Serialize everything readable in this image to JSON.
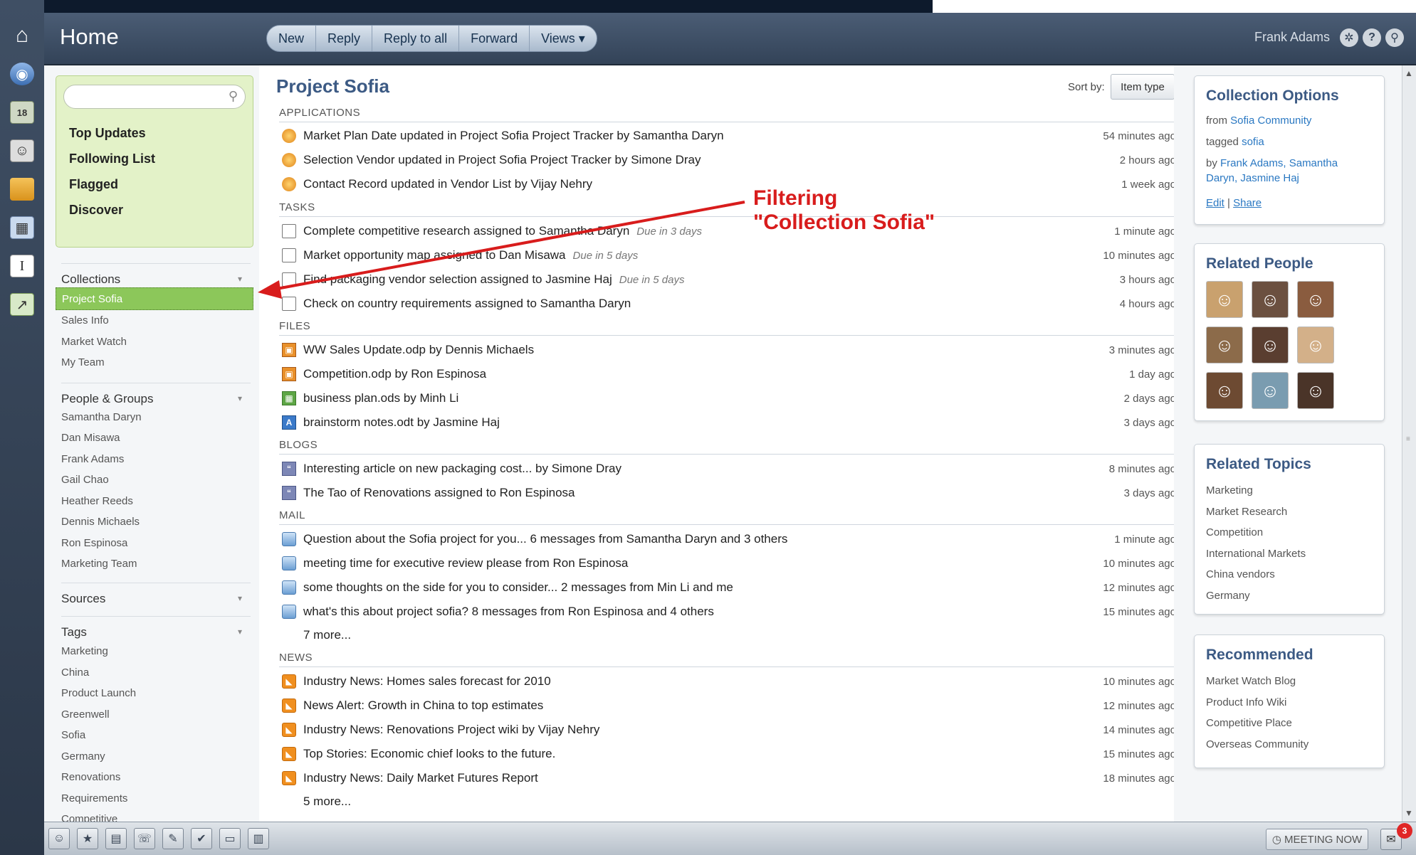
{
  "header": {
    "title": "Home",
    "toolbar": [
      "New",
      "Reply",
      "Reply to all",
      "Forward",
      "Views ▾"
    ],
    "user": "Frank Adams"
  },
  "left": {
    "search_placeholder": "",
    "nav": [
      "Top Updates",
      "Following List",
      "Flagged",
      "Discover"
    ],
    "collections": {
      "title": "Collections",
      "selected": "Project Sofia",
      "items": [
        "Sales Info",
        "Market Watch",
        "My Team"
      ]
    },
    "people": {
      "title": "People & Groups",
      "items": [
        "Samantha Daryn",
        "Dan Misawa",
        "Frank Adams",
        "Gail Chao",
        "Heather Reeds",
        "Dennis Michaels",
        "Ron Espinosa",
        "Marketing Team"
      ]
    },
    "sources": {
      "title": "Sources"
    },
    "tags": {
      "title": "Tags",
      "items": [
        "Marketing",
        "China",
        "Product Launch",
        "Greenwell",
        "Sofia",
        "Germany",
        "Renovations",
        "Requirements",
        "Competitive"
      ]
    }
  },
  "main": {
    "title": "Project Sofia",
    "sort_label": "Sort by:",
    "sort_value": "Item type",
    "groups": {
      "applications": {
        "title": "APPLICATIONS",
        "rows": [
          {
            "text": "Market Plan Date updated in Project Sofia Project Tracker by Samantha Daryn",
            "time": "54 minutes ago"
          },
          {
            "text": "Selection Vendor updated in Project Sofia Project Tracker by Simone Dray",
            "time": "2 hours ago"
          },
          {
            "text": "Contact Record updated in Vendor List by Vijay Nehry",
            "time": "1 week ago"
          }
        ]
      },
      "tasks": {
        "title": "TASKS",
        "rows": [
          {
            "text": "Complete competitive research assigned to Samantha Daryn",
            "due": "Due in 3 days",
            "time": "1 minute ago"
          },
          {
            "text": "Market opportunity map assigned to Dan Misawa",
            "due": "Due in 5 days",
            "time": "10 minutes ago"
          },
          {
            "text": "Find packaging vendor selection assigned to Jasmine Haj",
            "due": "Due in 5 days",
            "time": "3 hours ago"
          },
          {
            "text": "Check on country requirements assigned to Samantha Daryn",
            "due": "",
            "time": "4 hours ago"
          }
        ]
      },
      "files": {
        "title": "FILES",
        "rows": [
          {
            "text": "WW Sales Update.odp by Dennis Michaels",
            "time": "3 minutes ago",
            "icon": "odp"
          },
          {
            "text": "Competition.odp by Ron Espinosa",
            "time": "1 day ago",
            "icon": "odp"
          },
          {
            "text": "business plan.ods by Minh Li",
            "time": "2 days ago",
            "icon": "ods"
          },
          {
            "text": "brainstorm notes.odt by Jasmine Haj",
            "time": "3 days ago",
            "icon": "odt"
          }
        ]
      },
      "blogs": {
        "title": "BLOGS",
        "rows": [
          {
            "text": "Interesting article on new packaging cost... by Simone Dray",
            "time": "8 minutes ago"
          },
          {
            "text": "The Tao of Renovations assigned to Ron Espinosa",
            "time": "3 days ago"
          }
        ]
      },
      "mail": {
        "title": "MAIL",
        "rows": [
          {
            "text": "Question about the Sofia project for you... 6 messages from Samantha Daryn and 3 others",
            "time": "1 minute ago"
          },
          {
            "text": "meeting time for executive review please from Ron Espinosa",
            "time": "10 minutes ago"
          },
          {
            "text": "some thoughts on the side for you to consider... 2 messages from Min Li and me",
            "time": "12 minutes ago"
          },
          {
            "text": "what's this about project sofia? 8 messages from Ron Espinosa and 4 others",
            "time": "15 minutes ago"
          }
        ],
        "more": "7 more..."
      },
      "news": {
        "title": "NEWS",
        "rows": [
          {
            "text": "Industry News: Homes sales forecast for 2010",
            "time": "10 minutes ago"
          },
          {
            "text": "News Alert: Growth in China to top estimates",
            "time": "12 minutes ago"
          },
          {
            "text": "Industry News: Renovations Project wiki by Vijay Nehry",
            "time": "14 minutes ago"
          },
          {
            "text": "Top Stories: Economic chief looks to the future.",
            "time": "15 minutes ago"
          },
          {
            "text": "Industry News: Daily Market Futures Report",
            "time": "18 minutes ago"
          }
        ],
        "more": "5 more..."
      }
    }
  },
  "annotation": {
    "text": "Filtering\n\"Collection Sofia\"",
    "color": "#d81c1c"
  },
  "right": {
    "collection_options": {
      "title": "Collection Options",
      "from_label": "from",
      "from_value": "Sofia Community",
      "tagged_label": "tagged",
      "tagged_value": "sofia",
      "by_label": "by",
      "by_line1": "Frank Adams, Samantha",
      "by_line2": "Daryn, Jasmine Haj",
      "edit": "Edit",
      "sep": "|",
      "share": "Share"
    },
    "related_people": {
      "title": "Related People"
    },
    "related_topics": {
      "title": "Related Topics",
      "items": [
        "Marketing",
        "Market Research",
        "Competition",
        "International Markets",
        "China vendors",
        "Germany"
      ]
    },
    "recommended": {
      "title": "Recommended",
      "items": [
        "Market Watch Blog",
        "Product Info Wiki",
        "Competitive Place",
        "Overseas Community"
      ]
    }
  },
  "bottom": {
    "meeting": "MEETING NOW",
    "chat_badge": "3"
  }
}
